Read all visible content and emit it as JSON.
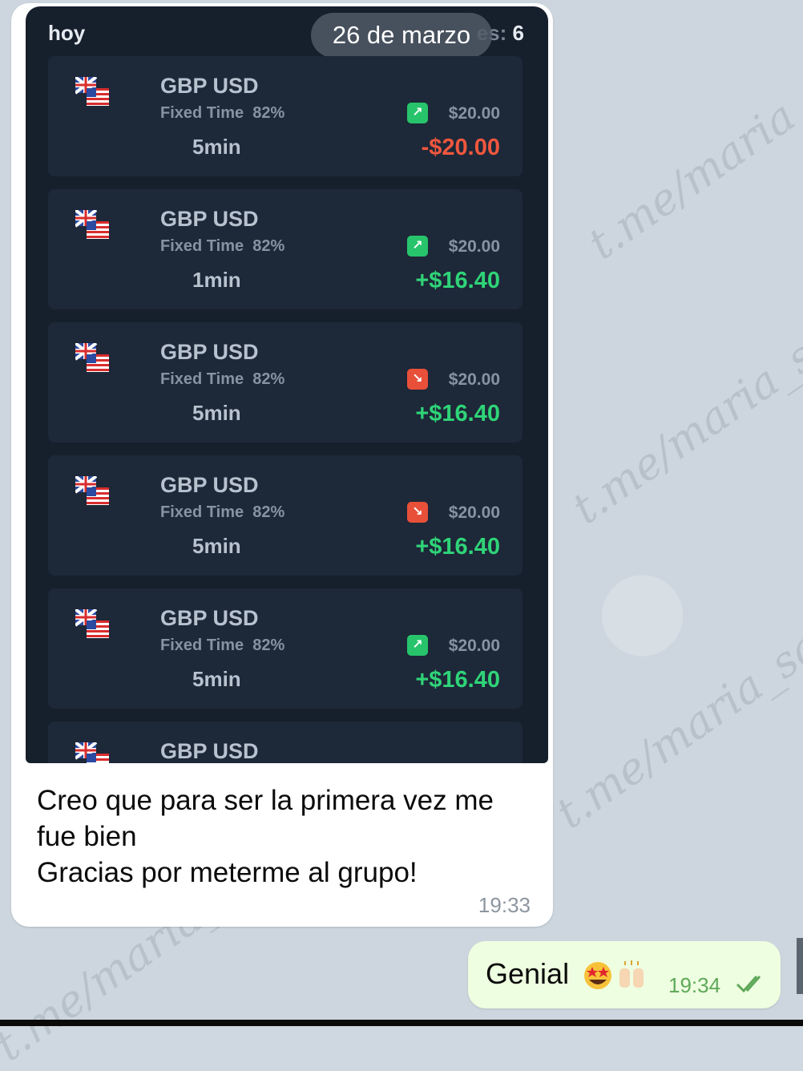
{
  "screenshot": {
    "header_left": "hoy",
    "date_badge": "26 de marzo",
    "header_right_faded": "es:",
    "header_right_value": "6",
    "trades": [
      {
        "pair": "GBP USD",
        "type": "Fixed Time",
        "payout": "82%",
        "duration": "5min",
        "direction": "up",
        "amount": "$20.00",
        "result": "-$20.00",
        "result_sign": "neg"
      },
      {
        "pair": "GBP USD",
        "type": "Fixed Time",
        "payout": "82%",
        "duration": "1min",
        "direction": "up",
        "amount": "$20.00",
        "result": "+$16.40",
        "result_sign": "pos"
      },
      {
        "pair": "GBP USD",
        "type": "Fixed Time",
        "payout": "82%",
        "duration": "5min",
        "direction": "down",
        "amount": "$20.00",
        "result": "+$16.40",
        "result_sign": "pos"
      },
      {
        "pair": "GBP USD",
        "type": "Fixed Time",
        "payout": "82%",
        "duration": "5min",
        "direction": "down",
        "amount": "$20.00",
        "result": "+$16.40",
        "result_sign": "pos"
      },
      {
        "pair": "GBP USD",
        "type": "Fixed Time",
        "payout": "82%",
        "duration": "5min",
        "direction": "up",
        "amount": "$20.00",
        "result": "+$16.40",
        "result_sign": "pos"
      },
      {
        "pair": "GBP USD"
      }
    ],
    "colors": {
      "up": "#27c46b",
      "down": "#e8503a",
      "positive": "#2fd478",
      "negative": "#f0573e"
    }
  },
  "incoming": {
    "line1": "Creo que para ser la primera vez me",
    "line2": "fue bien",
    "line3": "Gracias por meterme al grupo!",
    "time": "19:33"
  },
  "outgoing": {
    "text": "Genial",
    "emojis": [
      "star-struck-face-icon",
      "raising-hands-icon"
    ],
    "time": "19:34",
    "status": "double-check-read-icon"
  },
  "watermark": "t.me/maria_sanz"
}
